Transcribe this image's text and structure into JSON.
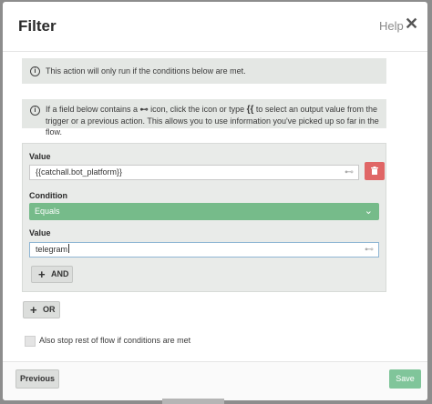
{
  "dialog": {
    "title": "Filter",
    "help_label": "Help",
    "close_glyph": "✕"
  },
  "notices": {
    "info_glyph": "i",
    "conditions_notice": "This action will only run if the conditions below are met.",
    "field_help": {
      "part1": "If a field below contains a ",
      "part2": " icon, click the icon or type ",
      "bracket": "{{",
      "part3": " to select an output value from the trigger or a previous action. This allows you to use information you've picked up so far in the flow."
    }
  },
  "condition": {
    "value_label_1": "Value",
    "value_1": "{{catchall.bot_platform}}",
    "condition_label": "Condition",
    "operator": "Equals",
    "value_label_2": "Value",
    "value_2": "telegram",
    "and_button": "AND"
  },
  "or_button": "OR",
  "stop_checkbox": {
    "label": "Also stop rest of flow if conditions are met",
    "checked": false
  },
  "footer": {
    "previous_label": "Previous",
    "save_label": "Save"
  },
  "colors": {
    "accent_green": "#76bb8a",
    "save_green": "#80c59a",
    "delete_red": "#e06666"
  },
  "icons": [
    "close-icon",
    "info-icon",
    "link-icon",
    "trash-icon",
    "chevron-down-icon",
    "plus-icon"
  ]
}
